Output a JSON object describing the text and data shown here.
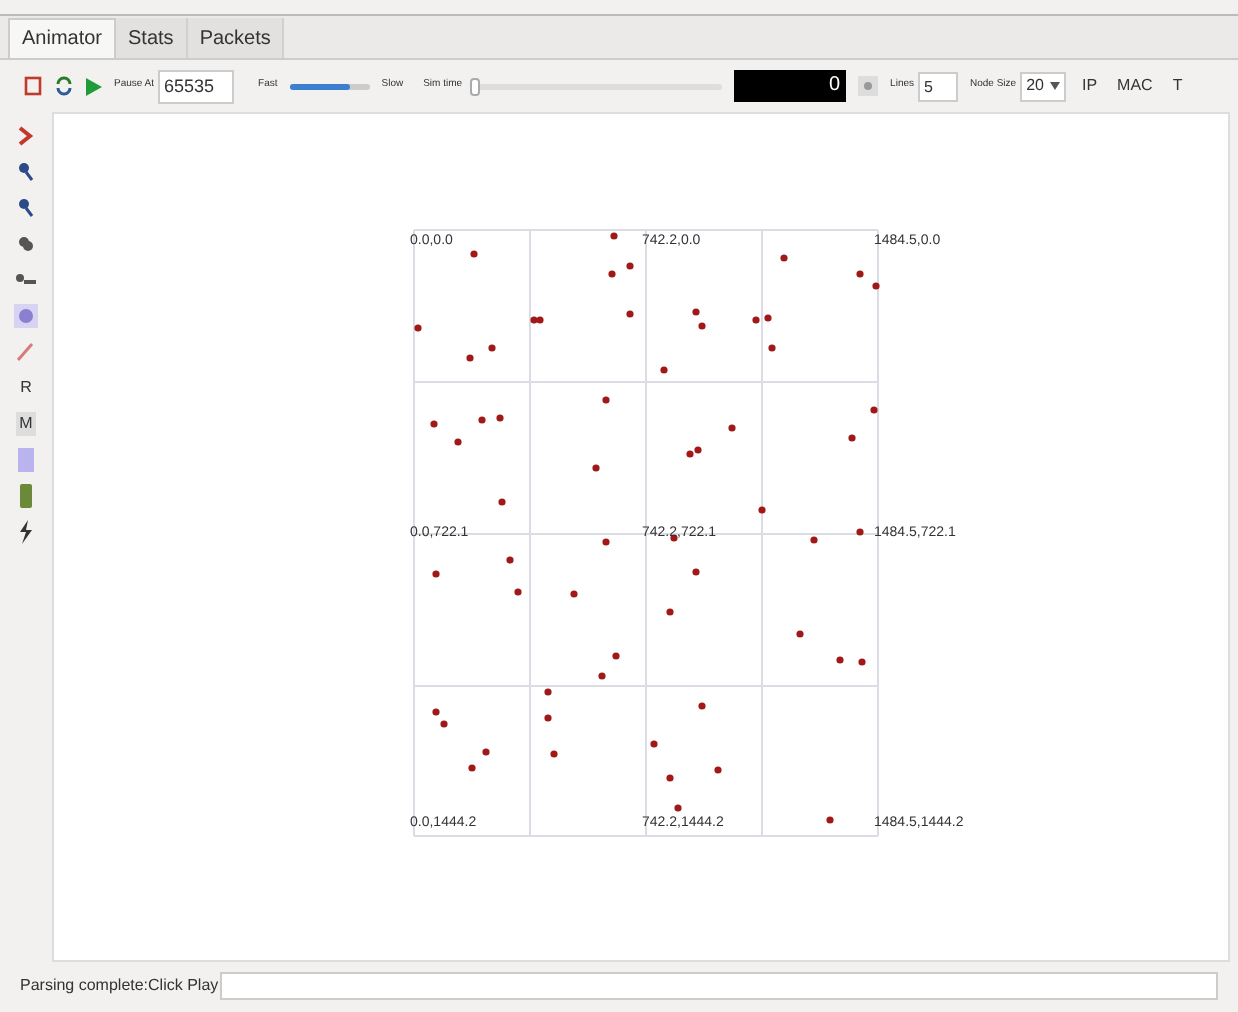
{
  "tabs": [
    {
      "label": "Animator",
      "selected": true
    },
    {
      "label": "Stats",
      "selected": false
    },
    {
      "label": "Packets",
      "selected": false
    }
  ],
  "toolbar": {
    "pause_label": "Pause At",
    "pause_value": "65535",
    "fast_label": "Fast",
    "speed": {
      "level": 0.75
    },
    "slow_label": "Slow",
    "sim_time_label": "Sim time",
    "sim_time": {
      "level": 0.0
    },
    "time_display": "0",
    "lines_label": "Lines",
    "lines_value": "5",
    "node_size_label": "Node Size",
    "node_size_value": "20",
    "toggles": [
      "IP",
      "MAC",
      "T"
    ]
  },
  "side_tools": [
    {
      "kind": "icon"
    },
    {
      "kind": "icon"
    },
    {
      "kind": "icon"
    },
    {
      "kind": "icon"
    },
    {
      "kind": "icon"
    },
    {
      "kind": "icon"
    },
    {
      "kind": "icon"
    },
    {
      "kind": "text",
      "label": "R"
    },
    {
      "kind": "text",
      "label": "M"
    },
    {
      "kind": "icon"
    },
    {
      "kind": "icon"
    },
    {
      "kind": "icon"
    }
  ],
  "grid_labels": [
    "0.0,0.0",
    "742.2,0.0",
    "1484.5,0.0",
    "0.0,722.1",
    "742.2,722.1",
    "1484.5,722.1",
    "0.0,1444.2",
    "742.2,1444.2",
    "1484.5,1444.2"
  ],
  "status": {
    "message": "Parsing complete:Click Play"
  }
}
